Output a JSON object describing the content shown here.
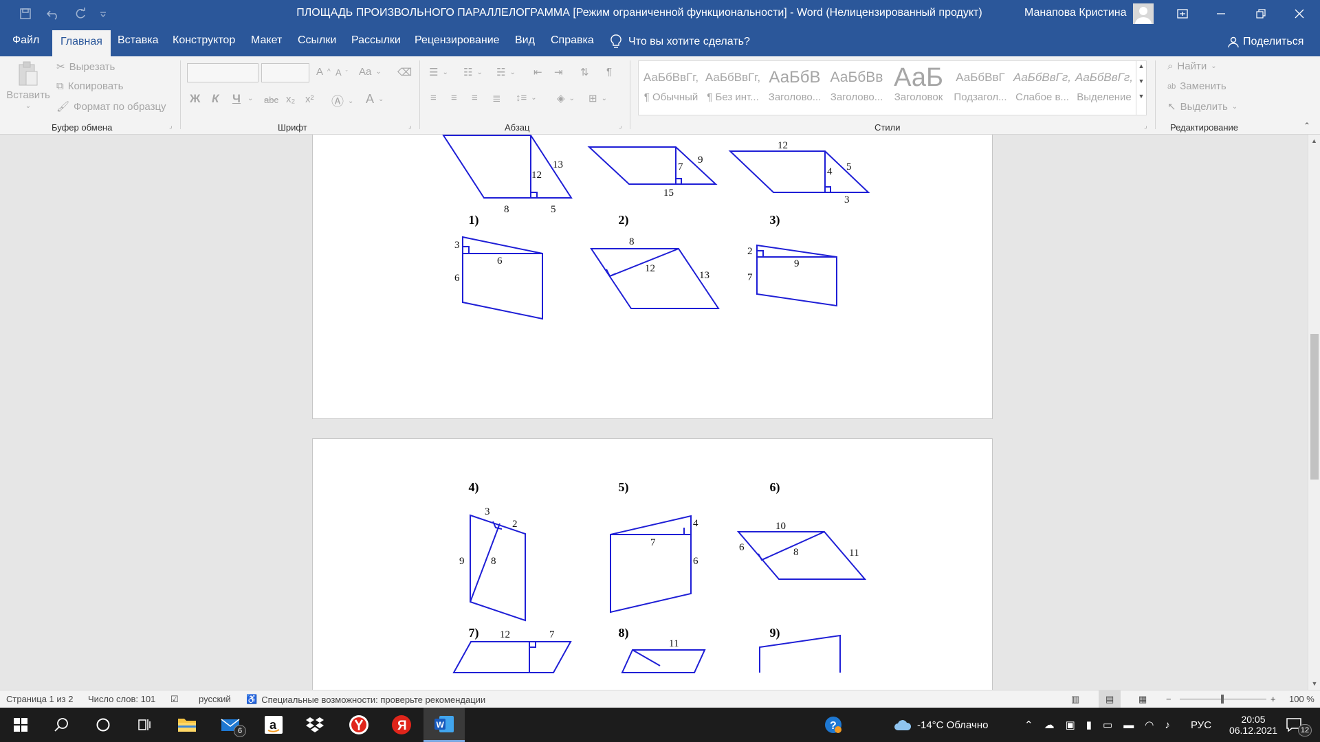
{
  "window": {
    "title": "ПЛОЩАДЬ ПРОИЗВОЛЬНОГО ПАРАЛЛЕЛОГРАММА [Режим ограниченной функциональности]  -  Word (Нелицензированный продукт)",
    "user_name": "Манапова Кристина"
  },
  "tabs": [
    "Файл",
    "Главная",
    "Вставка",
    "Конструктор",
    "Макет",
    "Ссылки",
    "Рассылки",
    "Рецензирование",
    "Вид",
    "Справка"
  ],
  "tell_me": "Что вы хотите сделать?",
  "share": "Поделиться",
  "clipboard": {
    "paste": "Вставить",
    "cut": "Вырезать",
    "copy": "Копировать",
    "format_painter": "Формат по образцу",
    "label": "Буфер обмена"
  },
  "font_group": {
    "label": "Шрифт",
    "bold": "Ж",
    "italic": "К",
    "underline": "Ч",
    "strike": "abc",
    "sub": "x₂",
    "sup": "x²",
    "grow": "A",
    "shrink": "A",
    "case": "Aa"
  },
  "paragraph_group": {
    "label": "Абзац"
  },
  "styles_group": {
    "label": "Стили",
    "items": [
      {
        "preview": "АаБбВвГг,",
        "name": "¶ Обычный"
      },
      {
        "preview": "АаБбВвГг,",
        "name": "¶ Без инт..."
      },
      {
        "preview": "АаБбВ",
        "name": "Заголово..."
      },
      {
        "preview": "АаБбВв",
        "name": "Заголово..."
      },
      {
        "preview": "АаБ",
        "name": "Заголовок"
      },
      {
        "preview": "АаБбВвГ",
        "name": "Подзагол..."
      },
      {
        "preview": "АаБбВвГг,",
        "name": "Слабое в..."
      },
      {
        "preview": "АаБбВвГг,",
        "name": "Выделение"
      }
    ]
  },
  "editing_group": {
    "label": "Редактирование",
    "find": "Найти",
    "replace": "Заменить",
    "select": "Выделить"
  },
  "document": {
    "page1_captions": [
      "1)",
      "2)",
      "3)"
    ],
    "page2_captions_a": [
      "4)",
      "5)",
      "6)"
    ],
    "page2_captions_b": [
      "7)",
      "8)",
      "9)"
    ],
    "fig_labels": {
      "f1": [
        "12",
        "13",
        "8",
        "5"
      ],
      "f2": [
        "7",
        "9",
        "15"
      ],
      "f3": [
        "12",
        "4",
        "5",
        "3"
      ],
      "f4": [
        "3",
        "6",
        "6"
      ],
      "f5": [
        "8",
        "12",
        "13"
      ],
      "f6": [
        "2",
        "9",
        "7"
      ],
      "f7": [
        "3",
        "2",
        "9",
        "8"
      ],
      "f8": [
        "4",
        "7",
        "6"
      ],
      "f9": [
        "10",
        "6",
        "8",
        "11"
      ],
      "f10": [
        "12",
        "7"
      ],
      "f11": [
        "11"
      ]
    }
  },
  "status": {
    "page": "Страница 1 из 2",
    "words": "Число слов: 101",
    "language": "русский",
    "accessibility": "Специальные возможности: проверьте рекомендации",
    "zoom": "100 %"
  },
  "taskbar": {
    "mail_badge": "6",
    "weather": "-14°C  Облачно",
    "lang": "РУС",
    "time": "20:05",
    "date": "06.12.2021",
    "notifications": "12"
  }
}
